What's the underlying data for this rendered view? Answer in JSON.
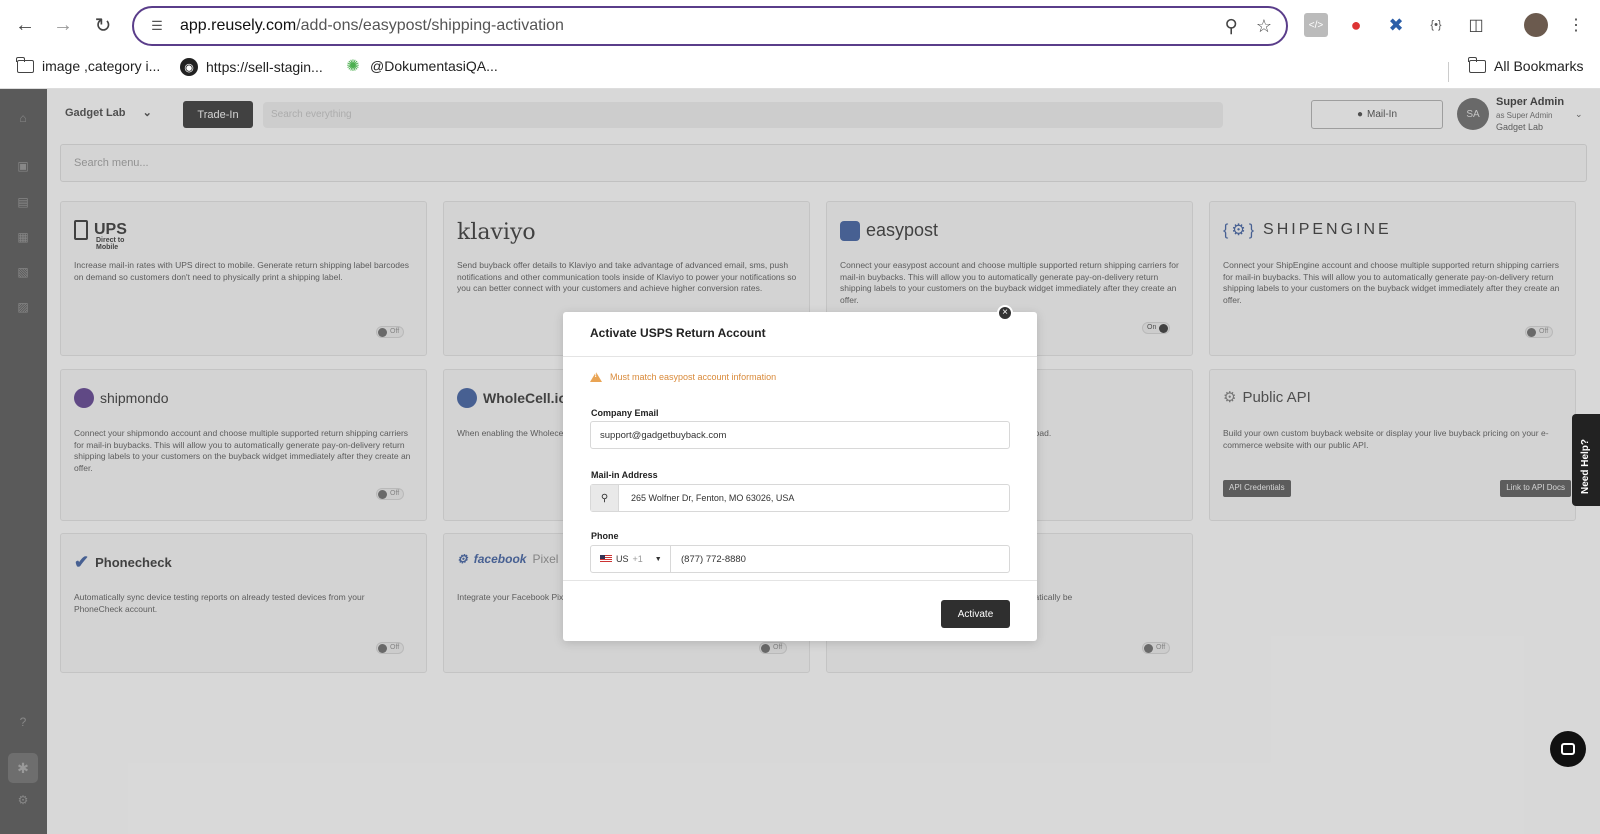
{
  "browser": {
    "url_host": "app.reusely.com",
    "url_path": "/add-ons/easypost/shipping-activation",
    "bookmarks": [
      {
        "label": "image ,category i...",
        "icon": "folder-icon"
      },
      {
        "label": "https://sell-stagin...",
        "icon": "globe-icon"
      },
      {
        "label": "@DokumentasiQA...",
        "icon": "leaf-icon"
      }
    ],
    "all_bookmarks": "All Bookmarks"
  },
  "header": {
    "store_name": "Gadget Lab",
    "trade_in_label": "Trade-In",
    "search_placeholder": "Search everything",
    "mail_in_label": "Mail-In",
    "avatar_initials": "SA",
    "user_name": "Super Admin",
    "user_role": "as Super Admin",
    "user_store": "Gadget Lab"
  },
  "search_menu_placeholder": "Search menu...",
  "cards": [
    {
      "name": "UPS",
      "sub": "Direct to Mobile",
      "desc": "Increase mail-in rates with UPS direct to mobile. Generate return shipping label barcodes on demand so customers don't need to physically print a shipping label.",
      "toggle": "Off"
    },
    {
      "name": "klaviyo",
      "desc": "Send buyback offer details to Klaviyo and take advantage of advanced email, sms, push notifications and other communication tools inside of Klaviyo to power your notifications so you can better connect with your customers and achieve higher conversion rates.",
      "toggle": ""
    },
    {
      "name": "easypost",
      "desc": "Connect your easypost account and choose multiple supported return shipping carriers for mail-in buybacks. This will allow you to automatically generate pay-on-delivery return shipping labels to your customers on the buyback widget immediately after they create an offer.",
      "toggle": "On"
    },
    {
      "name": "SHIPENGINE",
      "desc": "Connect your ShipEngine account and choose multiple supported return shipping carriers for mail-in buybacks. This will allow you to automatically generate pay-on-delivery return shipping labels to your customers on the buyback widget immediately after they create an offer.",
      "toggle": "Off"
    },
    {
      "name": "shipmondo",
      "desc": "Connect your shipmondo account and choose multiple supported return shipping carriers for mail-in buybacks. This will allow you to automatically generate pay-on-delivery return shipping labels to your customers on the buyback widget immediately after they create an offer.",
      "toggle": "Off"
    },
    {
      "name": "WholeCell.io",
      "desc": "When enabling the Wholece... automatically have a Purch... inventory.",
      "toggle": ""
    },
    {
      "name": "",
      "desc": "...downloads) to other platforms. Simply ... quick upload.",
      "toggle": ""
    },
    {
      "name": "Public API",
      "desc": "Build your own custom buyback website or display your live buyback pricing on your e-commerce website with our public API.",
      "btn1": "API Credentials",
      "btn2": "Link to API Docs"
    },
    {
      "name": "Phonecheck",
      "desc": "Automatically sync device testing reports on already tested devices from your PhoneCheck account.",
      "toggle": "Off"
    },
    {
      "name": "facebook",
      "sub": "Pixel",
      "desc": "Integrate your Facebook Pix... necessary to run successfu...",
      "toggle": "Off"
    },
    {
      "name": "",
      "desc": "...back locations. Buyback offers, ...count will automatically be",
      "toggle": "Off"
    }
  ],
  "modal": {
    "title": "Activate USPS Return Account",
    "warning": "Must match easypost account information",
    "email_label": "Company Email",
    "email_value": "support@gadgetbuyback.com",
    "address_label": "Mail-in Address",
    "address_value": "265 Wolfner Dr, Fenton, MO 63026, USA",
    "phone_label": "Phone",
    "country_code": "US",
    "dial_code": "+1",
    "phone_value": "(877) 772-8880",
    "activate_label": "Activate"
  },
  "need_help": "Need Help?",
  "colors": {
    "accent_url": "#5a3d8a",
    "warning": "#d98a3a",
    "sidebar": "#5a5a5a",
    "button_dark": "#2f2f2f"
  }
}
